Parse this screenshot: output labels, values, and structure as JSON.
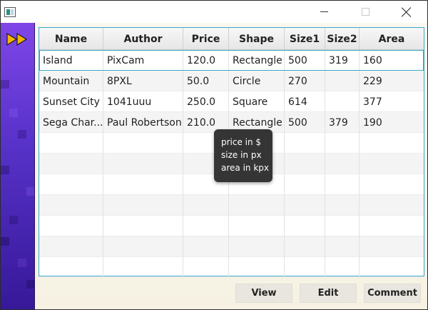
{
  "window": {
    "icons": {
      "app": "app-icon",
      "minimize": "minimize-icon",
      "maximize": "maximize-icon",
      "close": "close-icon"
    }
  },
  "sidebar": {
    "icon": "fast-forward-icon",
    "accent": "#f3b400",
    "background": "#5a2fd0"
  },
  "table": {
    "columns": [
      "Name",
      "Author",
      "Price",
      "Shape",
      "Size1",
      "Size2",
      "Area"
    ],
    "rows": [
      [
        "Island",
        "PixCam",
        "120.0",
        "Rectangle",
        "500",
        "319",
        "160"
      ],
      [
        "Mountain",
        "8PXL",
        "50.0",
        "Circle",
        "270",
        "",
        "229"
      ],
      [
        "Sunset City",
        "1041uuu",
        "250.0",
        "Square",
        "614",
        "",
        "377"
      ],
      [
        "Sega Char...",
        "Paul Robertson",
        "210.0",
        "Rectangle",
        "500",
        "379",
        "190"
      ]
    ],
    "selected_row": 0,
    "empty_rows": 7,
    "border_color": "#3aa7c9"
  },
  "tooltip": {
    "lines": [
      "price in $",
      "size in px",
      "area in kpx"
    ]
  },
  "buttons": {
    "view": "View",
    "edit": "Edit",
    "comment": "Comment"
  }
}
